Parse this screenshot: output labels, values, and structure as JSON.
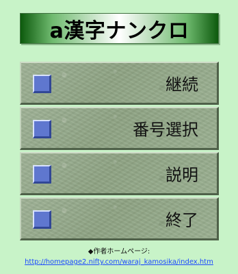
{
  "title": "a漢字ナンクロ",
  "menu": {
    "items": [
      {
        "label": "継続",
        "icon": "blue-square-icon"
      },
      {
        "label": "番号選択",
        "icon": "blue-square-icon"
      },
      {
        "label": "説明",
        "icon": "blue-square-icon"
      },
      {
        "label": "終了",
        "icon": "blue-square-icon"
      }
    ]
  },
  "footer": {
    "author_label": "◆作者ホームページ:",
    "author_url": "http://homepage2.nifty.com/waraj_kamosika/index.htm"
  },
  "colors": {
    "background": "#c8f3c8",
    "banner_dark_green": "#0d5a0d",
    "button_gray_green": "#8ea383",
    "icon_blue": "#5f77cf",
    "link_blue": "#1b48ff"
  }
}
